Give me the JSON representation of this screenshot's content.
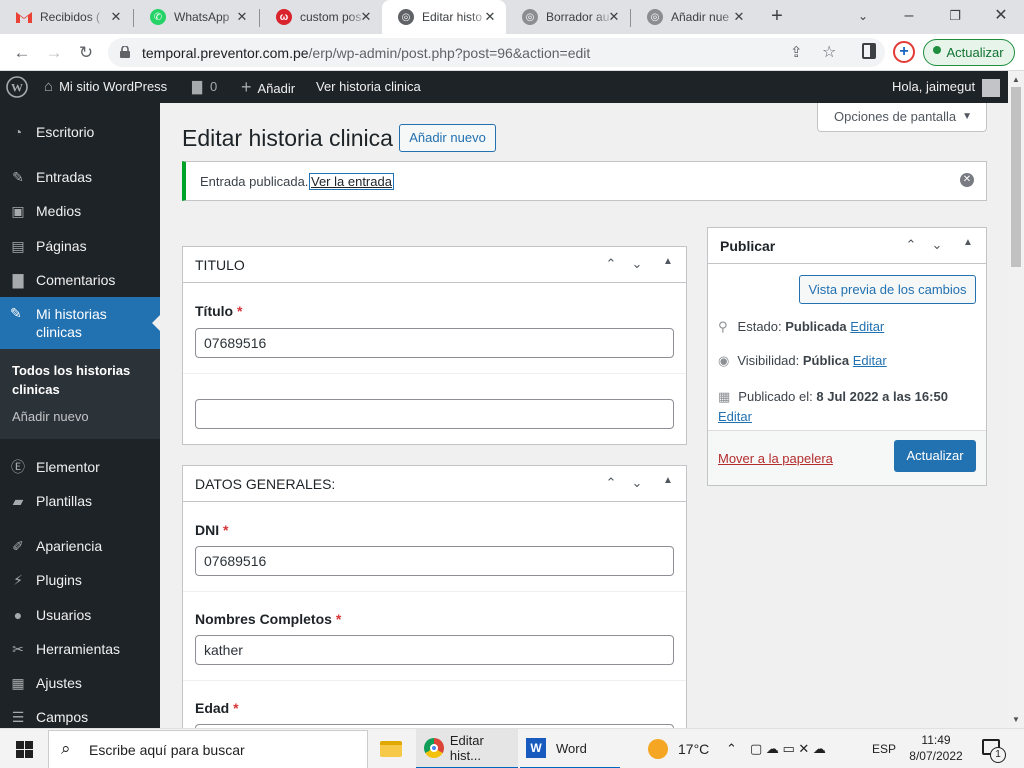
{
  "browser": {
    "tabs": [
      {
        "label": "Recibidos (",
        "favicon": "gmail-icon"
      },
      {
        "label": "WhatsApp",
        "favicon": "whatsapp-icon"
      },
      {
        "label": "custom pos",
        "favicon": "wordpress-red-icon"
      },
      {
        "label": "Editar histo",
        "favicon": "globe-icon"
      },
      {
        "label": "Borrador au",
        "favicon": "globe-icon"
      },
      {
        "label": "Añadir nue",
        "favicon": "globe-icon"
      }
    ],
    "url_host": "temporal.preventor.com.pe",
    "url_path": "/erp/wp-admin/post.php?post=96&action=edit",
    "update_label": "Actualizar"
  },
  "adminbar": {
    "site": "Mi sitio WordPress",
    "comments_count": "0",
    "add_new": "Añadir",
    "view": "Ver historia clinica",
    "greeting": "Hola, jaimegut"
  },
  "sidebar": {
    "items": [
      {
        "label": "Escritorio",
        "icon": "dashboard-icon"
      },
      {
        "label": "Entradas",
        "icon": "pin-icon"
      },
      {
        "label": "Medios",
        "icon": "media-icon"
      },
      {
        "label": "Páginas",
        "icon": "pages-icon"
      },
      {
        "label": "Comentarios",
        "icon": "comment-icon"
      }
    ],
    "active_line1": "Mi historias",
    "active_line2": "clinicas",
    "sub_all_line1": "Todos los historias",
    "sub_all_line2": "clinicas",
    "sub_add": "Añadir nuevo",
    "items2": [
      {
        "label": "Elementor",
        "icon": "elementor-icon"
      },
      {
        "label": "Plantillas",
        "icon": "folder-icon"
      },
      {
        "label": "Apariencia",
        "icon": "brush-icon"
      },
      {
        "label": "Plugins",
        "icon": "plugin-icon"
      },
      {
        "label": "Usuarios",
        "icon": "user-icon"
      },
      {
        "label": "Herramientas",
        "icon": "wrench-icon"
      },
      {
        "label": "Ajustes",
        "icon": "settings-icon"
      },
      {
        "label": "Campos",
        "icon": "fields-icon"
      }
    ]
  },
  "main": {
    "screen_options": "Opciones de pantalla",
    "page_title": "Editar historia clinica",
    "add_new": "Añadir nuevo",
    "notice_text": "Entrada publicada.",
    "notice_link": "Ver la entrada",
    "box_titulo": {
      "title": "TITULO",
      "label": "Título",
      "required": "*",
      "value": "07689516",
      "value2": ""
    },
    "box_datos": {
      "title": "DATOS GENERALES:",
      "dni_label": "DNI",
      "dni_value": "07689516",
      "nombres_label": "Nombres Completos",
      "nombres_value": "kather",
      "edad_label": "Edad",
      "required": "*"
    },
    "publish": {
      "title": "Publicar",
      "preview": "Vista previa de los cambios",
      "status_label": "Estado:",
      "status_value": "Publicada",
      "visibility_label": "Visibilidad:",
      "visibility_value": "Pública",
      "published_label": "Publicado el:",
      "published_value": "8 Jul 2022 a las 16:50",
      "edit": "Editar",
      "trash": "Mover a la papelera",
      "update": "Actualizar"
    }
  },
  "taskbar": {
    "search_placeholder": "Escribe aquí para buscar",
    "chrome_label": "Editar hist...",
    "word_label": "Word",
    "temperature": "17°C",
    "language": "ESP",
    "time": "11:49",
    "date": "8/07/2022",
    "notifications": "1"
  },
  "colors": {
    "wp_admin_dark": "#1d2327",
    "wp_blue": "#2271b1",
    "notice_green": "#00a32a",
    "link_red": "#b32d2e"
  }
}
